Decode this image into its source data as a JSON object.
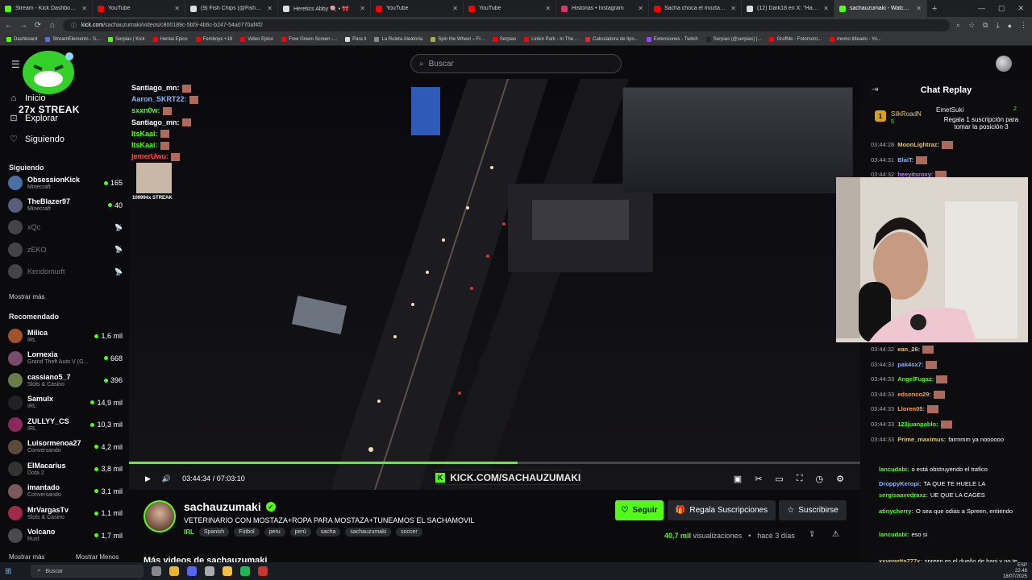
{
  "browser": {
    "tabs": [
      {
        "title": "Stream - Kick Dashboard",
        "color": "#53fc18",
        "active": false
      },
      {
        "title": "YouTube",
        "color": "#ff0000",
        "active": false
      },
      {
        "title": "(9) Fish Chips (@FishChips",
        "color": "#dddddd",
        "active": false
      },
      {
        "title": "Heretics Abby 🍭 • 🎀",
        "color": "#dddddd",
        "active": false
      },
      {
        "title": "YouTube",
        "color": "#ff0000",
        "active": false
      },
      {
        "title": "YouTube",
        "color": "#ff0000",
        "active": false
      },
      {
        "title": "Historias • Instagram",
        "color": "#e1306c",
        "active": false
      },
      {
        "title": "Sacha choca el moztadamóvil",
        "color": "#ff0000",
        "active": false
      },
      {
        "title": "(12) Dark18 en X: \"Hace 6 días",
        "color": "#dddddd",
        "active": false
      },
      {
        "title": "sachauzumaki - Watch the V",
        "color": "#53fc18",
        "active": true
      }
    ],
    "new_tab": "+",
    "url_domain": "kick.com",
    "url_path": "/sachauzumaki/videos/c800189c-5bf3-4b6c-b247-54a0770af4f2",
    "bookmarks": [
      "Dashboard",
      "StreamElements - S...",
      "Serpias | Kick",
      "Hentai Epico",
      "Femboys +18",
      "Video Epico",
      "Free Green Screen -...",
      "Para ti",
      "La Ruleta Aleatoria",
      "Spin the Wheel – Fr...",
      "Serpias",
      "Linkin Park - In The...",
      "Calculadora de tipo...",
      "Extensiones - Twitch",
      "Serpias (@serpias) |...",
      "GrafMe - Fotomont...",
      "momo tilteado - Yo..."
    ]
  },
  "header": {
    "streak_label": "27x STREAK",
    "search_placeholder": "Buscar"
  },
  "sidebar": {
    "nav": [
      {
        "label": "Inicio",
        "icon": "home-icon"
      },
      {
        "label": "Explorar",
        "icon": "compass-icon"
      },
      {
        "label": "Siguiendo",
        "icon": "heart-icon"
      }
    ],
    "following_title": "Siguiendo",
    "following": [
      {
        "name": "ObsessionKick",
        "category": "Minecraft",
        "viewers": "165",
        "online": true,
        "color": "#4a6fa5"
      },
      {
        "name": "TheBlazer97",
        "category": "Minecraft",
        "viewers": "40",
        "online": true,
        "color": "#5b5b7a"
      },
      {
        "name": "xQc",
        "category": "",
        "viewers": "📡",
        "online": false,
        "color": "#444"
      },
      {
        "name": "zEKO",
        "category": "",
        "viewers": "📡",
        "online": false,
        "color": "#444"
      },
      {
        "name": "Kendomurft",
        "category": "",
        "viewers": "📡",
        "online": false,
        "color": "#444"
      }
    ],
    "following_more": "Mostrar más",
    "recommended_title": "Recomendado",
    "recommended": [
      {
        "name": "Milica",
        "category": "IRL",
        "viewers": "1,6 mil",
        "color": "#a0522d"
      },
      {
        "name": "Lornexia",
        "category": "Grand Theft Auto V (G...",
        "viewers": "668",
        "color": "#7a4a6a"
      },
      {
        "name": "cassiano5_7",
        "category": "Slots & Casino",
        "viewers": "396",
        "color": "#6a7a4a"
      },
      {
        "name": "Samulx",
        "category": "IRL",
        "viewers": "14,9 mil",
        "color": "#222"
      },
      {
        "name": "ZULLYY_CS",
        "category": "IRL",
        "viewers": "10,3 mil",
        "color": "#8a2a5a"
      },
      {
        "name": "Luisormenoa27",
        "category": "Conversando",
        "viewers": "4,2 mil",
        "color": "#5a4a3a"
      },
      {
        "name": "ElMacarius",
        "category": "Dota 2",
        "viewers": "3,8 mil",
        "color": "#333"
      },
      {
        "name": "imantado",
        "category": "Conversando",
        "viewers": "3,1 mil",
        "color": "#7a5a5a"
      },
      {
        "name": "MrVargasTv",
        "category": "Slots & Casino",
        "viewers": "1,1 mil",
        "color": "#a02a4a"
      },
      {
        "name": "Volcano",
        "category": "Rust",
        "viewers": "1,7 mil",
        "color": "#4a4a4a"
      }
    ],
    "show_more": "Mostrar más",
    "show_less": "Mostrar Menos"
  },
  "video": {
    "overlay_chat": [
      {
        "user": "Santiago_mn:",
        "color": "#ffffff"
      },
      {
        "user": "Aaron_SKRT22:",
        "color": "#8ab4ff"
      },
      {
        "user": "sxxn0w:",
        "color": "#53fc18"
      },
      {
        "user": "Santiago_mn:",
        "color": "#ffffff"
      },
      {
        "user": "ItsKaai:",
        "color": "#53fc18"
      },
      {
        "user": "ItsKaai:",
        "color": "#53fc18"
      },
      {
        "user": "jemerUwu:",
        "color": "#ff4d4d"
      }
    ],
    "overlay_streak": "109994x STREAK",
    "time_current": "03:44:34",
    "time_total": "07:03:10",
    "time_separator": "/",
    "progress": 0.531,
    "watermark": "KICK.COM/SACHAUZUMAKI",
    "watermark_logo": "K"
  },
  "channel": {
    "name": "sachauzumaki",
    "title": "VETERINARIO CON MOSTAZA+ROPA PARA MOSTAZA+TUNEAMOS EL SACHAMOVIL",
    "category": "IRL",
    "tags": [
      "Spanish",
      "Fútbol",
      "peru",
      "perú",
      "sacha",
      "sachauzumaki",
      "soccer"
    ],
    "follow_label": "Seguir",
    "gift_label": "Regala Suscripciones",
    "subscribe_label": "Suscribirse",
    "views_count": "40,7 mil",
    "views_label": "visualizaciones",
    "date": "hace 3 días",
    "more_videos": "Más videos de sachauzumaki"
  },
  "chat": {
    "title": "Chat Replay",
    "pinned": {
      "rank": "1",
      "user1": "SilkRoadN",
      "user1_count": "5",
      "user2": "EmetSuki",
      "user2_count": "2",
      "message": "Regala 1 suscripción para tomar la posición 3"
    },
    "messages": [
      {
        "ts": "03:44:28",
        "user": "MoonLightraz:",
        "color": "#e3c46a",
        "text": ""
      },
      {
        "ts": "03:44:31",
        "user": "BlaiT:",
        "color": "#8ab4ff",
        "text": ""
      },
      {
        "ts": "03:44:32",
        "user": "heeyitsroxy:",
        "color": "#c27bff",
        "text": ""
      },
      {
        "ts": "03:44:32",
        "user": "ean_26:",
        "color": "#e3c46a",
        "text": ""
      },
      {
        "ts": "03:44:33",
        "user": "pak4sx7:",
        "color": "#8ab4ff",
        "text": ""
      },
      {
        "ts": "03:44:33",
        "user": "AngelFugaz:",
        "color": "#53fc18",
        "text": ""
      },
      {
        "ts": "03:44:33",
        "user": "edsonco29:",
        "color": "#ff9f40",
        "text": ""
      },
      {
        "ts": "03:44:33",
        "user": "Lloren05:",
        "color": "#ff9f40",
        "text": ""
      },
      {
        "ts": "03:44:33",
        "user": "123juanpablo:",
        "color": "#53fc18",
        "text": ""
      },
      {
        "ts": "03:44:33",
        "user": "Prime_maximus:",
        "color": "#e3c46a",
        "text": "farmmm ya noooooo"
      }
    ],
    "messages_overlap": [
      {
        "user": "lancudabi:",
        "color": "#53fc18",
        "text": "o está obstruyendo el trafico"
      },
      {
        "user": "DroppyKeropi:",
        "color": "#8ab4ff",
        "text": "TA QUE TE HUELE LA"
      },
      {
        "user": "sergisaavedraxz:",
        "color": "#53fc18",
        "text": "UE QUE LA CAGES"
      },
      {
        "user": "atinycherry:",
        "color": "#53fc18",
        "text": "O sea que odias a Spreen, entiendo"
      },
      {
        "user": "lancudabi:",
        "color": "#53fc18",
        "text": "eso si"
      },
      {
        "user": "xxvegetta777x:",
        "color": "#e3c46a",
        "text": "spreen es el dueño de bani y no te deja verlo"
      }
    ]
  },
  "taskbar": {
    "search_label": "Buscar",
    "time": "22:48",
    "date": "18/07/2025",
    "lang": "ESP"
  }
}
